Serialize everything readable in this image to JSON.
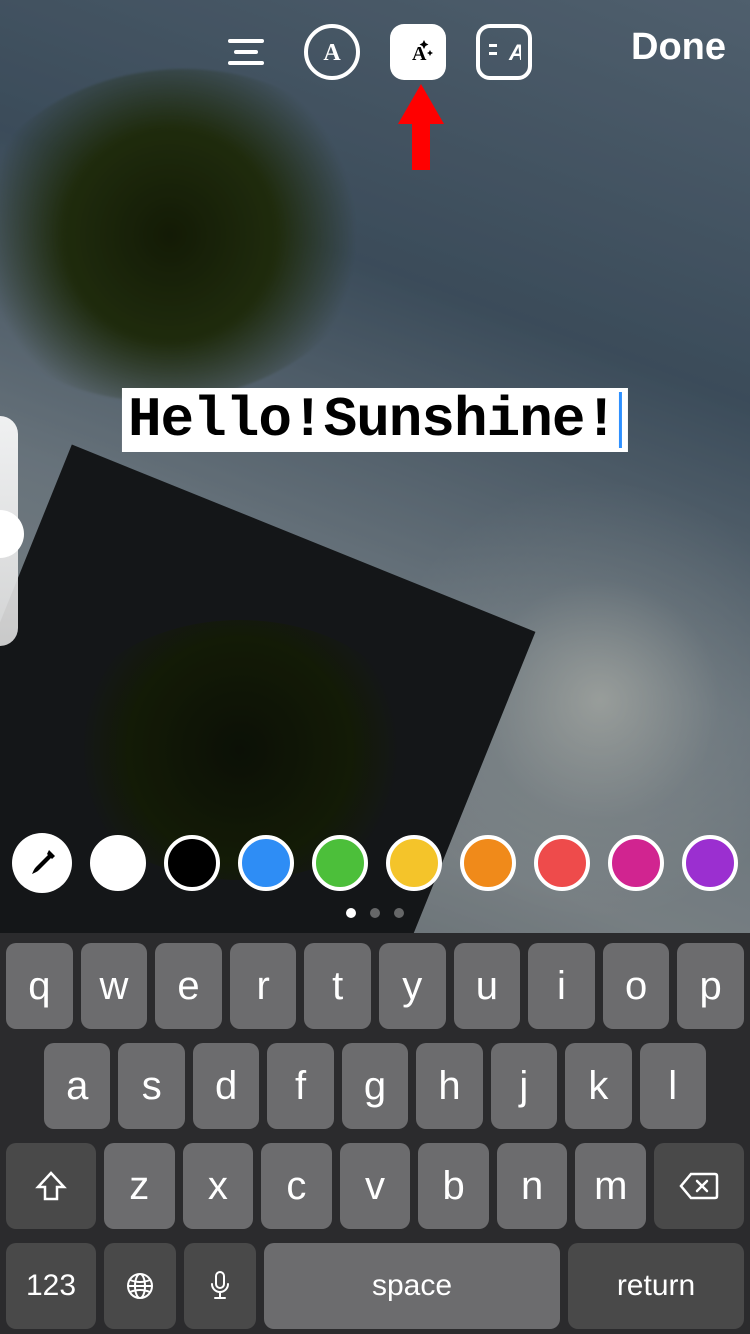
{
  "toolbar": {
    "done_label": "Done"
  },
  "text_overlay": {
    "value": "Hello!Sunshine!"
  },
  "palette": {
    "colors": [
      "#ffffff",
      "#000000",
      "#2e8df5",
      "#4cbf3a",
      "#f4c42a",
      "#f08a1a",
      "#ee4b4b",
      "#d12490",
      "#9b2fd0"
    ]
  },
  "page_dots": {
    "active": 0,
    "count": 3
  },
  "keyboard": {
    "row1": [
      "q",
      "w",
      "e",
      "r",
      "t",
      "y",
      "u",
      "i",
      "o",
      "p"
    ],
    "row2": [
      "a",
      "s",
      "d",
      "f",
      "g",
      "h",
      "j",
      "k",
      "l"
    ],
    "row3": [
      "z",
      "x",
      "c",
      "v",
      "b",
      "n",
      "m"
    ],
    "numbers": "123",
    "space": "space",
    "return": "return"
  }
}
